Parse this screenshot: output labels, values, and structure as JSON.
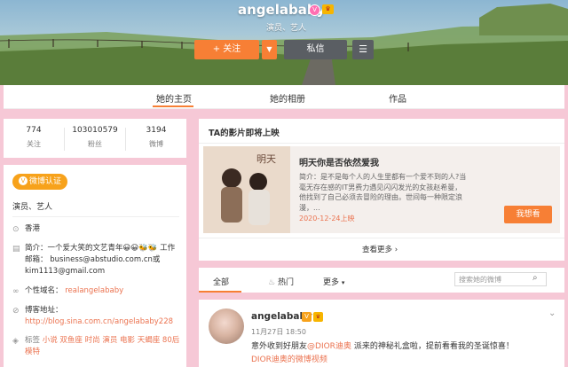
{
  "profile": {
    "username": "angelababy",
    "subtitle": "演员、艺人",
    "follow_label": "+ 关注",
    "message_label": "私信"
  },
  "tabs": [
    {
      "label": "她的主页"
    },
    {
      "label": "她的相册"
    },
    {
      "label": "作品"
    }
  ],
  "stats": [
    {
      "value": "774",
      "label": "关注"
    },
    {
      "value": "103010579",
      "label": "粉丝"
    },
    {
      "value": "3194",
      "label": "微博"
    }
  ],
  "info": {
    "verify_label": "微博认证",
    "verify_text": "演员、艺人",
    "location": "香港",
    "intro_label": "简介：",
    "intro_text": "一个爱大笑的文艺青年😀😀🐝🐝 工作邮箱：  business@abstudio.com.cn或kim1113@gmail.com",
    "domain_label": "个性域名：",
    "domain_value": "realangelababy",
    "blog_label": "博客地址：",
    "blog_value": "http://blog.sina.com.cn/angelababy228",
    "tags_label": "标签",
    "tags_value": "小说 双鱼座 时尚 演员 电影 天蝎座 80后 模特"
  },
  "films": {
    "title": "TA的影片即将上映",
    "film_name": "明天你是否依然爱我",
    "description": "简介：是不是每个人的人生里都有一个爱不到的人?当毫无存在感的IT男费力遇见闪闪发光的女孩赵希曼，他找到了自己必须去冒险的理由。世间每一种限定浪漫，...",
    "date": "2020-12-24上映",
    "want_label": "我想看",
    "see_more": "查看更多"
  },
  "feed": {
    "tab_all": "全部",
    "tab_hot": "热门",
    "tab_more": "更多",
    "search_placeholder": "搜索她的微博"
  },
  "post": {
    "author": "angelababy",
    "time": "11月27日 18:50",
    "text_before": "意外收到好朋友",
    "mention": "@DIOR迪奥",
    "text_after": " 派来的神秘礼盒啦，提前看看我的圣诞惊喜！",
    "video_link": "DIOR迪奥的微博视频"
  },
  "colors": {
    "accent": "#f77f35",
    "page_bg": "#f6c8d6",
    "link": "#eb7350"
  }
}
